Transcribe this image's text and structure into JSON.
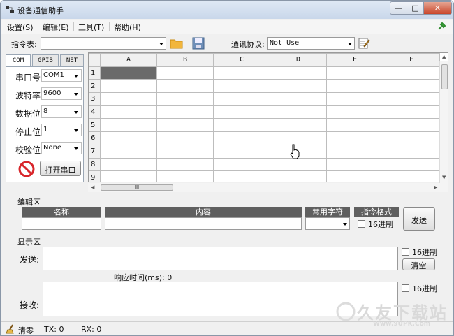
{
  "window": {
    "title": "设备通信助手",
    "min": "—",
    "max": "□",
    "close": "✕"
  },
  "menu": [
    {
      "label": "设置(S)"
    },
    {
      "label": "编辑(E)"
    },
    {
      "label": "工具(T)"
    },
    {
      "label": "帮助(H)"
    }
  ],
  "toolbar": {
    "cmd_table_label": "指令表:",
    "cmd_table_value": "",
    "protocol_label": "通讯协议:",
    "protocol_value": "Not Use"
  },
  "tabs": [
    "COM",
    "GPIB",
    "NET"
  ],
  "port_settings": [
    {
      "label": "串口号",
      "value": "COM1"
    },
    {
      "label": "波特率",
      "value": "9600"
    },
    {
      "label": "数据位",
      "value": "8"
    },
    {
      "label": "停止位",
      "value": "1"
    },
    {
      "label": "校验位",
      "value": "None"
    }
  ],
  "open_port_label": "打开串口",
  "grid": {
    "columns": [
      "A",
      "B",
      "C",
      "D",
      "E",
      "F"
    ],
    "rows": [
      "1",
      "2",
      "3",
      "4",
      "5",
      "6",
      "7",
      "8",
      "9"
    ],
    "selected_cell": "A1"
  },
  "hscroll_grip": "III",
  "edit_area": {
    "section_label": "编辑区",
    "name_header": "名称",
    "content_header": "内容",
    "common_char_header": "常用字符",
    "cmd_format_header": "指令格式",
    "hex_label": "16进制",
    "send_button": "发送"
  },
  "display_area": {
    "section_label": "显示区",
    "send_label": "发送:",
    "send_hex_label": "16进制",
    "clear_button": "清空",
    "response_time": "响应时间(ms): 0",
    "recv_label": "接收:",
    "recv_hex_label": "16进制"
  },
  "status": {
    "clear_label": "清零",
    "tx": "TX: 0",
    "rx": "RX: 0"
  },
  "watermark": {
    "text": "久友下载站",
    "url": "Www.9UPK.Com"
  },
  "colors": {
    "selected_cell": "#6a6a6a",
    "header_bar": "#5f5f5f",
    "stop_icon": "#d8262b"
  }
}
